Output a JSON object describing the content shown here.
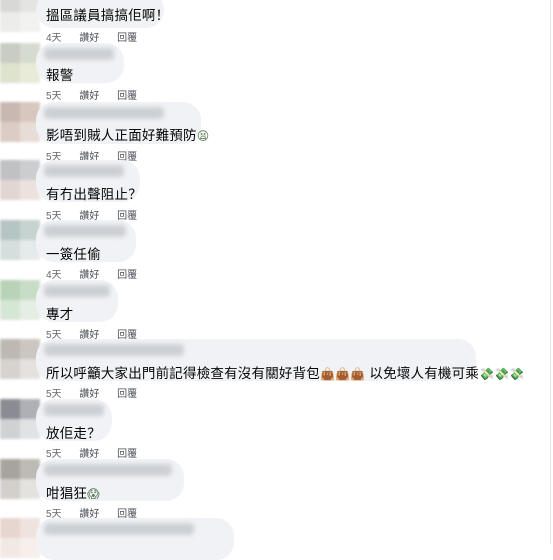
{
  "comments": [
    {
      "text": "搵區議員搞搞佢啊！",
      "time": "4天",
      "like": "讚好",
      "reply": "回覆",
      "emoji": ""
    },
    {
      "text": "報警",
      "time": "5天",
      "like": "讚好",
      "reply": "回覆",
      "emoji": ""
    },
    {
      "text": "影唔到賊人正面好難預防",
      "time": "5天",
      "like": "讚好",
      "reply": "回覆",
      "emoji": "😫"
    },
    {
      "text": "有冇出聲阻止？",
      "time": "5天",
      "like": "讚好",
      "reply": "回覆",
      "emoji": ""
    },
    {
      "text": "一簽任偷",
      "time": "4天",
      "like": "讚好",
      "reply": "回覆",
      "emoji": ""
    },
    {
      "text": "專才",
      "time": "5天",
      "like": "讚好",
      "reply": "回覆",
      "emoji": ""
    },
    {
      "text": "所以呼籲大家出門前記得檢查有沒有關好背包",
      "text2": "以免壞人有機可乘",
      "time": "5天",
      "like": "讚好",
      "reply": "回覆",
      "emoji": "👜👜👜",
      "emoji2": "💸💸💸"
    },
    {
      "text": "放佢走？",
      "time": "5天",
      "like": "讚好",
      "reply": "回覆",
      "emoji": ""
    },
    {
      "text": "咁猖狂",
      "time": "5天",
      "like": "讚好",
      "reply": "回覆",
      "emoji": "😱"
    }
  ]
}
